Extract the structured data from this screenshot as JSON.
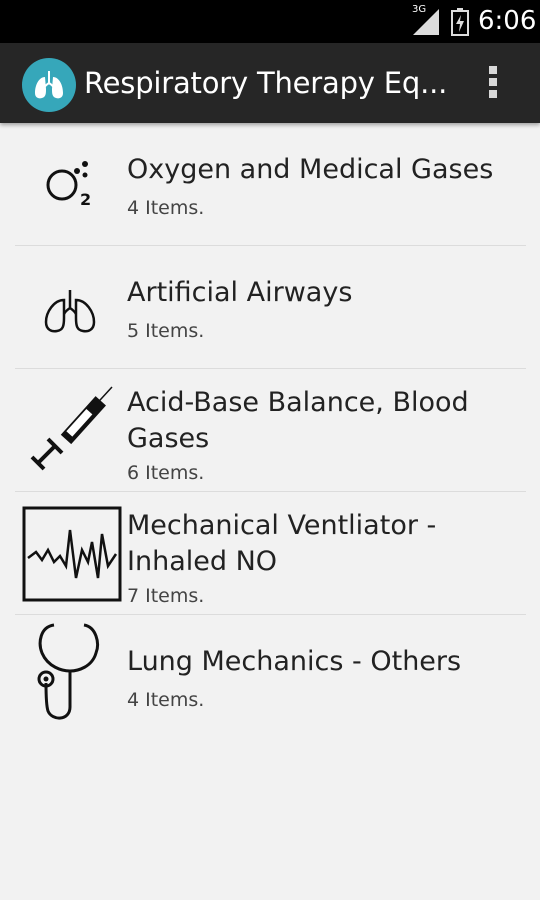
{
  "status": {
    "network": "3G",
    "time": "6:06"
  },
  "app": {
    "title": "Respiratory Therapy Eq..."
  },
  "items": [
    {
      "icon": "oxygen-icon",
      "title": "Oxygen and Medical Gases",
      "count": "4 Items."
    },
    {
      "icon": "lungs-icon",
      "title": "Artificial Airways",
      "count": "5 Items."
    },
    {
      "icon": "syringe-icon",
      "title": "Acid-Base Balance, Blood Gases",
      "count": "6 Items."
    },
    {
      "icon": "ventilator-icon",
      "title": "Mechanical Ventliator - Inhaled NO",
      "count": "7 Items."
    },
    {
      "icon": "stethoscope-icon",
      "title": "Lung Mechanics - Others",
      "count": "4 Items."
    }
  ]
}
